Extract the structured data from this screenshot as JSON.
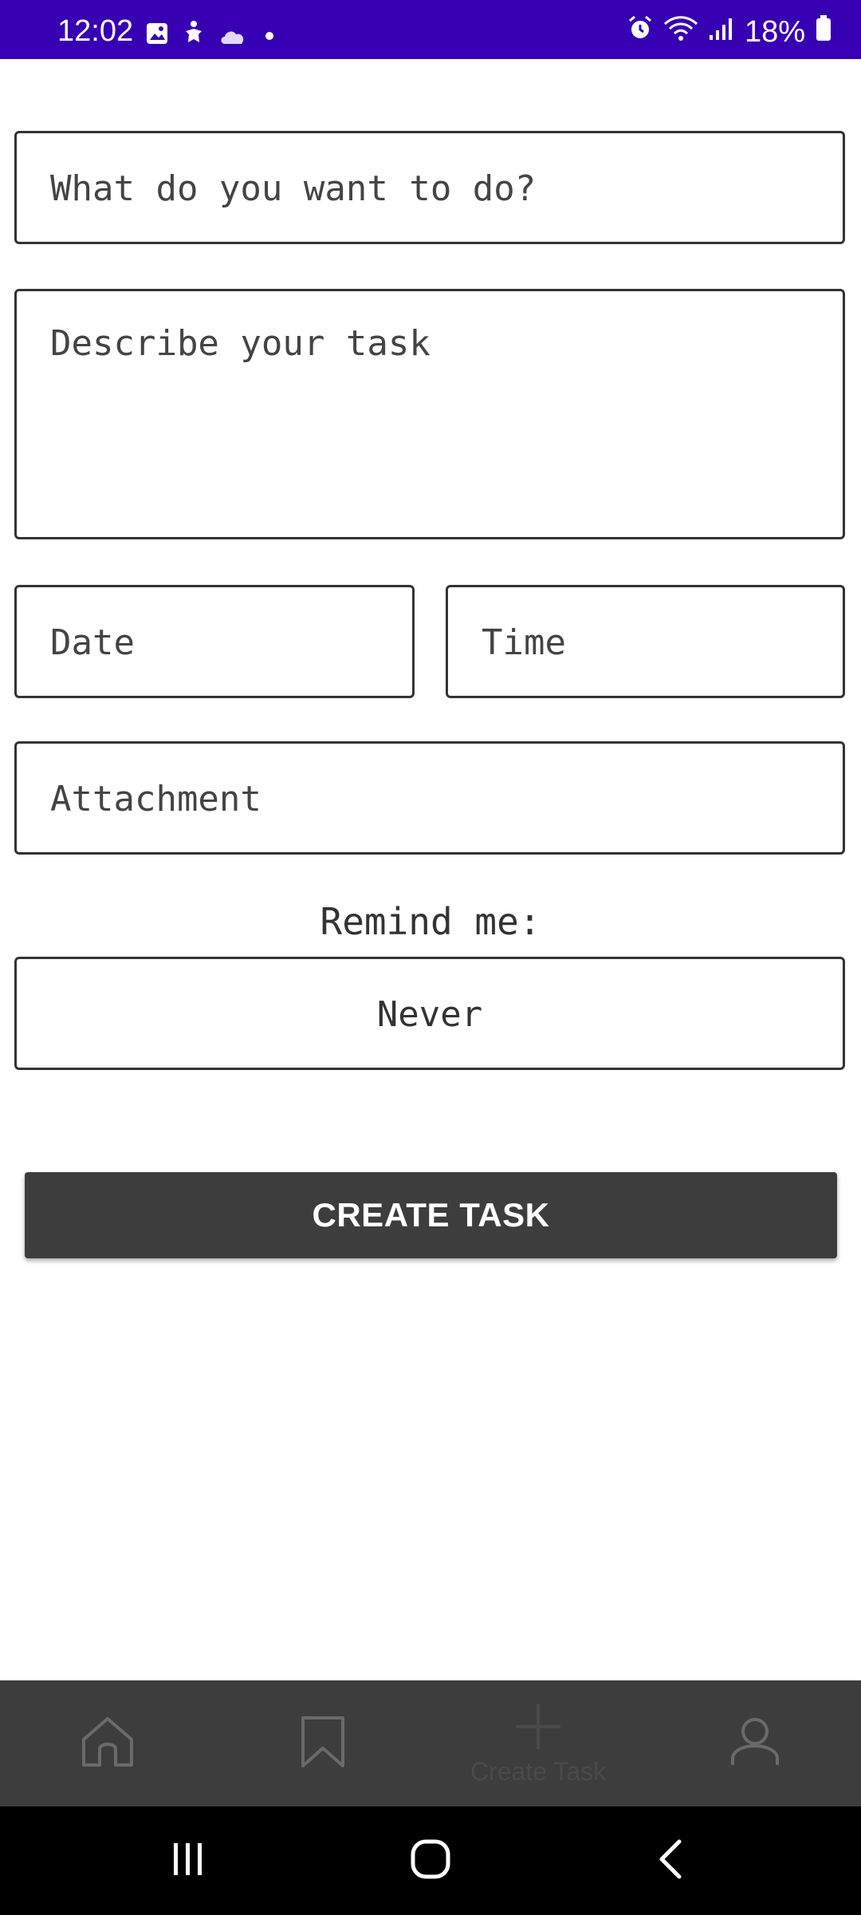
{
  "status_bar": {
    "time": "12:02",
    "battery": "18%",
    "icons_left": [
      "image-icon",
      "accessibility-icon",
      "cloud-icon",
      "dot-icon"
    ],
    "icons_right": [
      "alarm-icon",
      "wifi-icon",
      "signal-icon",
      "battery-icon"
    ],
    "background_color": "#3700b3"
  },
  "form": {
    "title_placeholder": "What do you want to do?",
    "description_placeholder": "Describe your task",
    "date_placeholder": "Date",
    "time_placeholder": "Time",
    "attachment_placeholder": "Attachment",
    "remind_label": "Remind me:",
    "remind_value": "Never"
  },
  "actions": {
    "create_label": "CREATE TASK",
    "button_color": "#3d3d3d"
  },
  "bottom_nav": {
    "items": [
      {
        "icon": "home-icon",
        "label": ""
      },
      {
        "icon": "bookmark-icon",
        "label": ""
      },
      {
        "icon": "plus-icon",
        "label": "Create Task"
      },
      {
        "icon": "profile-icon",
        "label": ""
      }
    ],
    "background_color": "#3d3d3d"
  },
  "system_nav": {
    "buttons": [
      "recents-icon",
      "home-circle-icon",
      "back-icon"
    ]
  }
}
